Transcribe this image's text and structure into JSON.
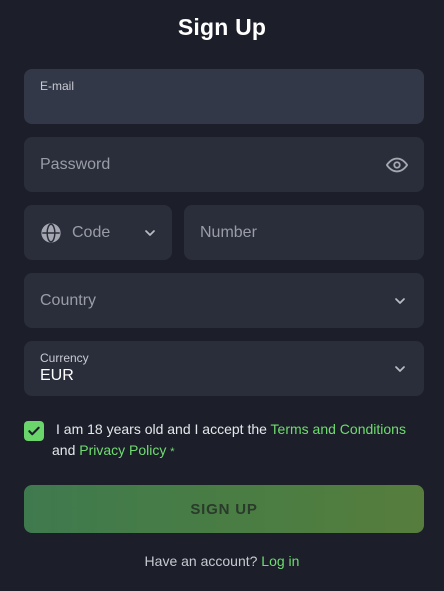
{
  "page": {
    "title": "Sign Up"
  },
  "form": {
    "email": {
      "label": "E-mail",
      "value": ""
    },
    "password": {
      "placeholder": "Password",
      "icon": "eye-icon"
    },
    "phone": {
      "code_placeholder": "Code",
      "code_icon": "globe-icon",
      "number_placeholder": "Number"
    },
    "country": {
      "placeholder": "Country",
      "icon": "chevron-down-icon"
    },
    "currency": {
      "label": "Currency",
      "value": "EUR",
      "icon": "chevron-down-icon"
    },
    "consent": {
      "checked": true,
      "text_before": "I am 18 years old and I accept the ",
      "terms_link": "Terms and Conditions",
      "and_text": " and ",
      "privacy_link": "Privacy Policy",
      "required_mark": "*"
    },
    "submit_label": "SIGN UP"
  },
  "footer": {
    "prompt": "Have an account?",
    "login_link": "Log in"
  },
  "colors": {
    "background": "#1c1f29",
    "field": "#2a2e3b",
    "accent": "#6fdc70",
    "button_gradient_start": "#3f7a4e",
    "button_gradient_end": "#567d3d"
  }
}
